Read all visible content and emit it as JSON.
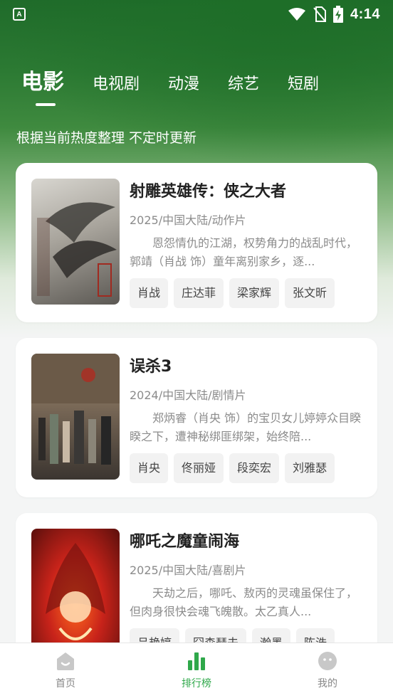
{
  "status_bar": {
    "app_badge": "A",
    "time": "4:14"
  },
  "tabs": [
    {
      "label": "电影",
      "active": true
    },
    {
      "label": "电视剧",
      "active": false
    },
    {
      "label": "动漫",
      "active": false
    },
    {
      "label": "综艺",
      "active": false
    },
    {
      "label": "短剧",
      "active": false
    }
  ],
  "subtitle": "根据当前热度整理 不定时更新",
  "movies": [
    {
      "title": "射雕英雄传：侠之大者",
      "meta": "2025/中国大陆/动作片",
      "description": "恩怨情仇的江湖，权势角力的战乱时代，郭靖（肖战 饰）童年离别家乡，逐...",
      "tags": [
        "肖战",
        "庄达菲",
        "梁家辉",
        "张文昕"
      ]
    },
    {
      "title": "误杀3",
      "meta": "2024/中国大陆/剧情片",
      "description": "郑炳睿（肖央 饰）的宝贝女儿婷婷众目睽睽之下，遭神秘绑匪绑架，始终陪...",
      "tags": [
        "肖央",
        "佟丽娅",
        "段奕宏",
        "刘雅瑟"
      ]
    },
    {
      "title": "哪吒之魔童闹海",
      "meta": "2025/中国大陆/喜剧片",
      "description": "天劫之后，哪吒、敖丙的灵魂虽保住了，但肉身很快会魂飞魄散。太乙真人...",
      "tags": [
        "吕艳婷",
        "囧森瑟夫",
        "瀚墨",
        "陈浩"
      ]
    }
  ],
  "bottom_nav": [
    {
      "label": "首页",
      "icon": "home-icon",
      "active": false
    },
    {
      "label": "排行榜",
      "icon": "ranking-icon",
      "active": true
    },
    {
      "label": "我的",
      "icon": "profile-icon",
      "active": false
    }
  ],
  "colors": {
    "accent": "#2fa84a",
    "header_green": "#1f6b2a"
  }
}
